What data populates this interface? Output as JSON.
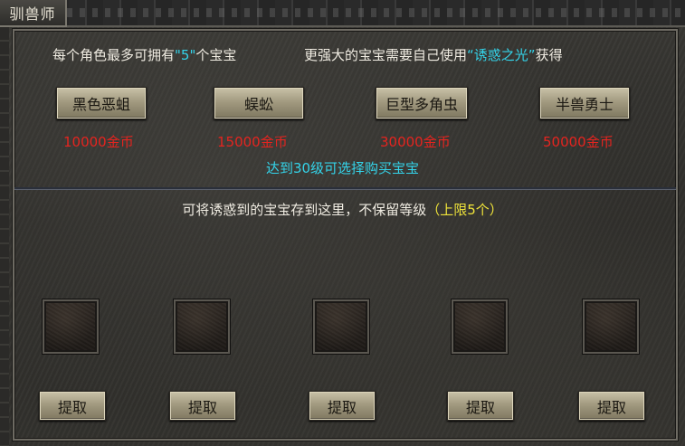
{
  "window": {
    "title": "驯兽师"
  },
  "info": {
    "limit_prefix": "每个角色最多可拥有",
    "limit_value": "\"5\"",
    "limit_suffix": "个宝宝",
    "stronger_prefix": "更强大的宝宝需要自己使用",
    "stronger_item": "“诱惑之光”",
    "stronger_suffix": "获得"
  },
  "pets": [
    {
      "name": "黑色恶蛆",
      "price": "10000金币"
    },
    {
      "name": "蜈蚣",
      "price": "15000金币"
    },
    {
      "name": "巨型多角虫",
      "price": "30000金币"
    },
    {
      "name": "半兽勇士",
      "price": "50000金币"
    }
  ],
  "level_note": "达到30级可选择购买宝宝",
  "storage": {
    "note_main": "可将诱惑到的宝宝存到这里，不保留等级",
    "note_limit": "（上限5个）",
    "slots": [
      {
        "button": "提取"
      },
      {
        "button": "提取"
      },
      {
        "button": "提取"
      },
      {
        "button": "提取"
      },
      {
        "button": "提取"
      }
    ]
  },
  "colors": {
    "highlight_cyan": "#34d4ea",
    "price_red": "#e5241f",
    "limit_yellow": "#f0e43a",
    "button_face": "#a29a80"
  }
}
